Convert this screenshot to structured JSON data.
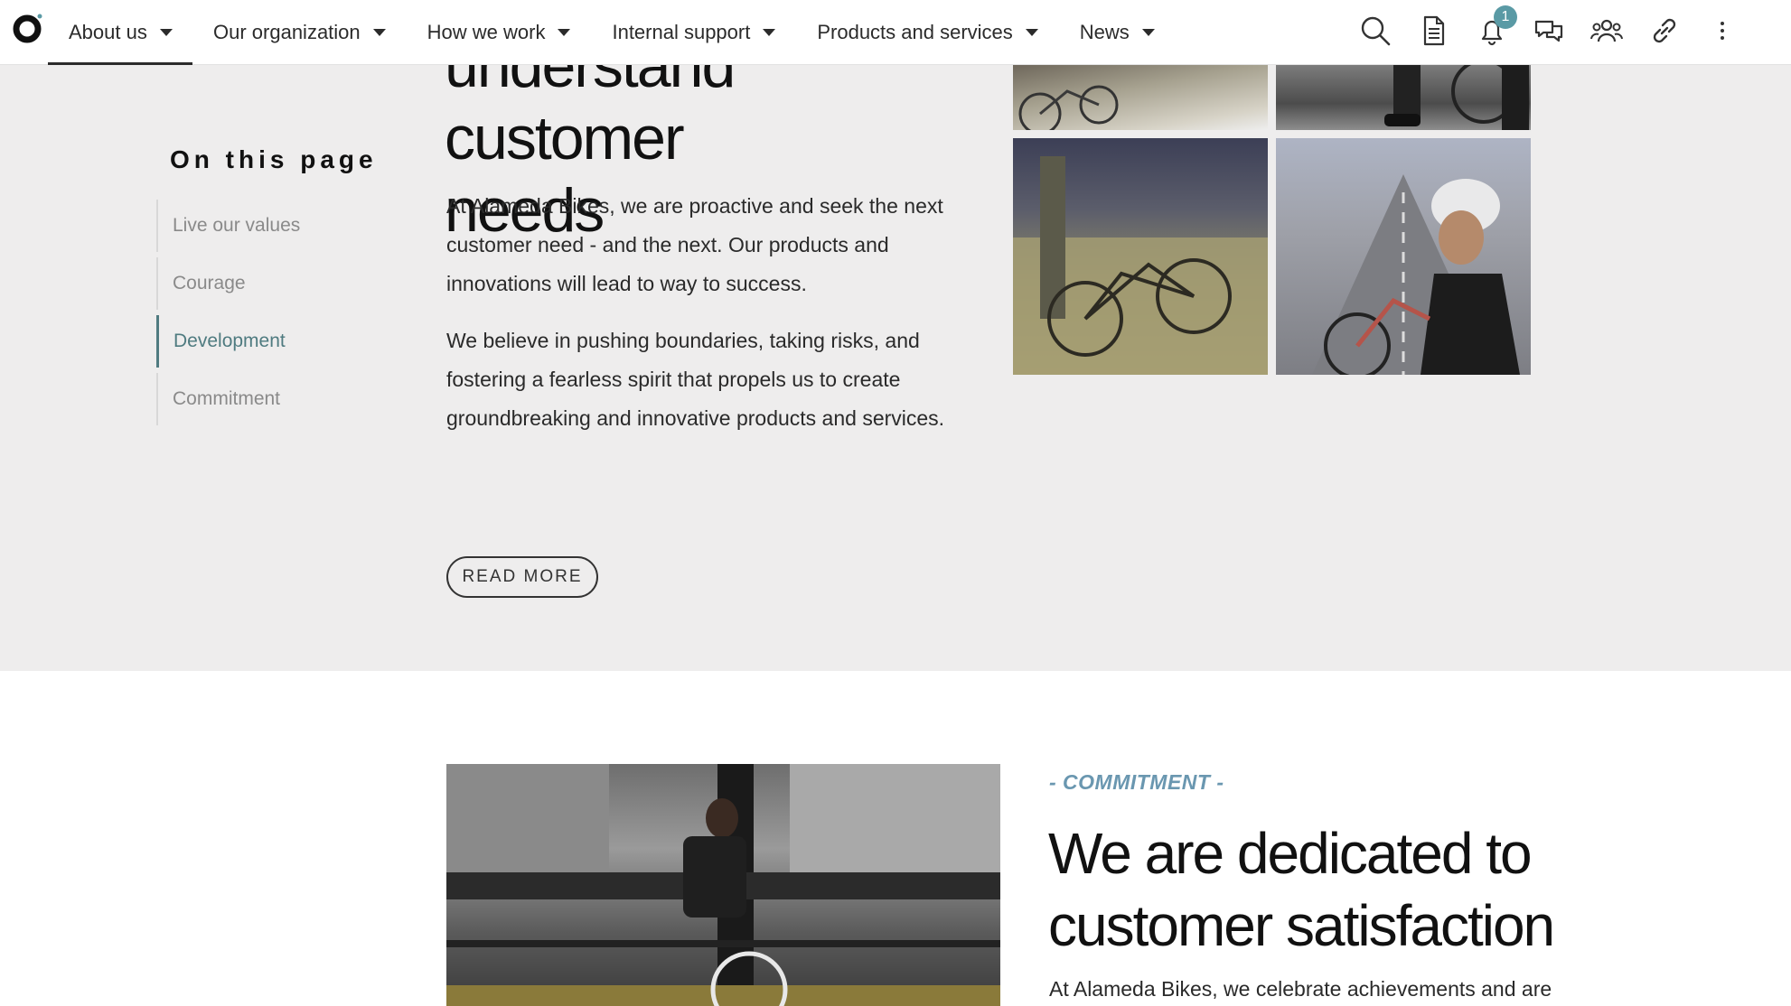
{
  "nav": {
    "items": [
      {
        "label": "About us"
      },
      {
        "label": "Our organization"
      },
      {
        "label": "How we work"
      },
      {
        "label": "Internal support"
      },
      {
        "label": "Products and services"
      },
      {
        "label": "News"
      }
    ],
    "active_index": 0
  },
  "tools": {
    "notification_count": "1",
    "icons": [
      "search-icon",
      "document-icon",
      "bell-icon",
      "chat-icon",
      "people-icon",
      "link-icon",
      "more-vertical-icon"
    ]
  },
  "toc": {
    "title": "On this page",
    "items": [
      {
        "label": "Live our values"
      },
      {
        "label": "Courage"
      },
      {
        "label": "Development"
      },
      {
        "label": "Commitment"
      }
    ],
    "active_index": 2
  },
  "development": {
    "heading_lines": [
      "understand customer",
      "needs"
    ],
    "paragraph_1": "At Alameda Bikes, we are proactive and seek the next customer need - and the next. Our products and innovations will lead to way to success.",
    "paragraph_2": "We believe in pushing boundaries, taking risks, and fostering a fearless spirit that propels us to create groundbreaking and innovative products and services.",
    "read_more": "READ MORE"
  },
  "commitment": {
    "eyebrow": "- COMMITMENT -",
    "heading": "We are dedicated to customer satisfaction",
    "paragraph": "At Alameda Bikes, we celebrate achievements and are"
  },
  "colors": {
    "accent": "#4f7b80",
    "eyebrow": "#6a97b0",
    "badge": "#5a9aa5",
    "section_bg": "#eeeded"
  }
}
